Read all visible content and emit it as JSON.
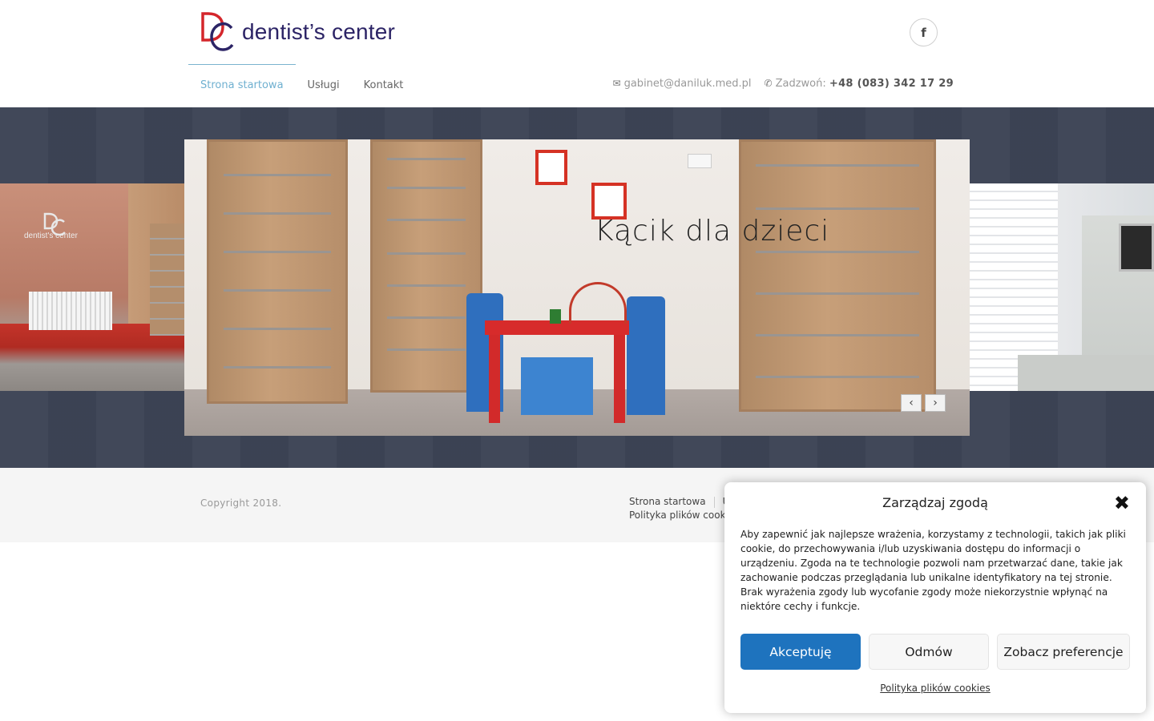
{
  "header": {
    "logo_text": "dentist’s center",
    "logo_monogram": "DC",
    "facebook_icon_glyph": "f",
    "nav": [
      {
        "label": "Strona startowa",
        "active": true
      },
      {
        "label": "Usługi",
        "active": false
      },
      {
        "label": "Kontakt",
        "active": false
      }
    ],
    "email": "gabinet@daniluk.med.pl",
    "phone_label": "Zadzwoń:",
    "phone": "+48 (083) 342 17 29",
    "icons": {
      "email": "envelope-icon",
      "phone": "phone-icon",
      "social": "facebook-icon"
    }
  },
  "slider": {
    "caption": "Kącik dla dzieci",
    "prev_glyph": "‹",
    "next_glyph": "›",
    "side_left_sign": "dentist's center"
  },
  "footer": {
    "copyright": "Copyright 2018.",
    "links": [
      "Strona startowa",
      "U",
      "Polityka plików cook"
    ]
  },
  "cookie": {
    "title": "Zarządzaj zgodą",
    "close_glyph": "✖",
    "text": "Aby zapewnić jak najlepsze wrażenia, korzystamy z technologii, takich jak pliki cookie, do przechowywania i/lub uzyskiwania dostępu do informacji o urządzeniu. Zgoda na te technologie pozwoli nam przetwarzać dane, takie jak zachowanie podczas przeglądania lub unikalne identyfikatory na tej stronie. Brak wyrażenia zgody lub wycofanie zgody może niekorzystnie wpłynąć na niektóre cechy i funkcje.",
    "accept": "Akceptuję",
    "deny": "Odmów",
    "prefs": "Zobacz preferencje",
    "policy_link": "Polityka plików cookies"
  },
  "colors": {
    "accent_blue": "#1e73be",
    "nav_active": "#6fb0d0",
    "band_bg": "#3d4456",
    "logo_red": "#d4262b",
    "logo_navy": "#2c2466"
  }
}
